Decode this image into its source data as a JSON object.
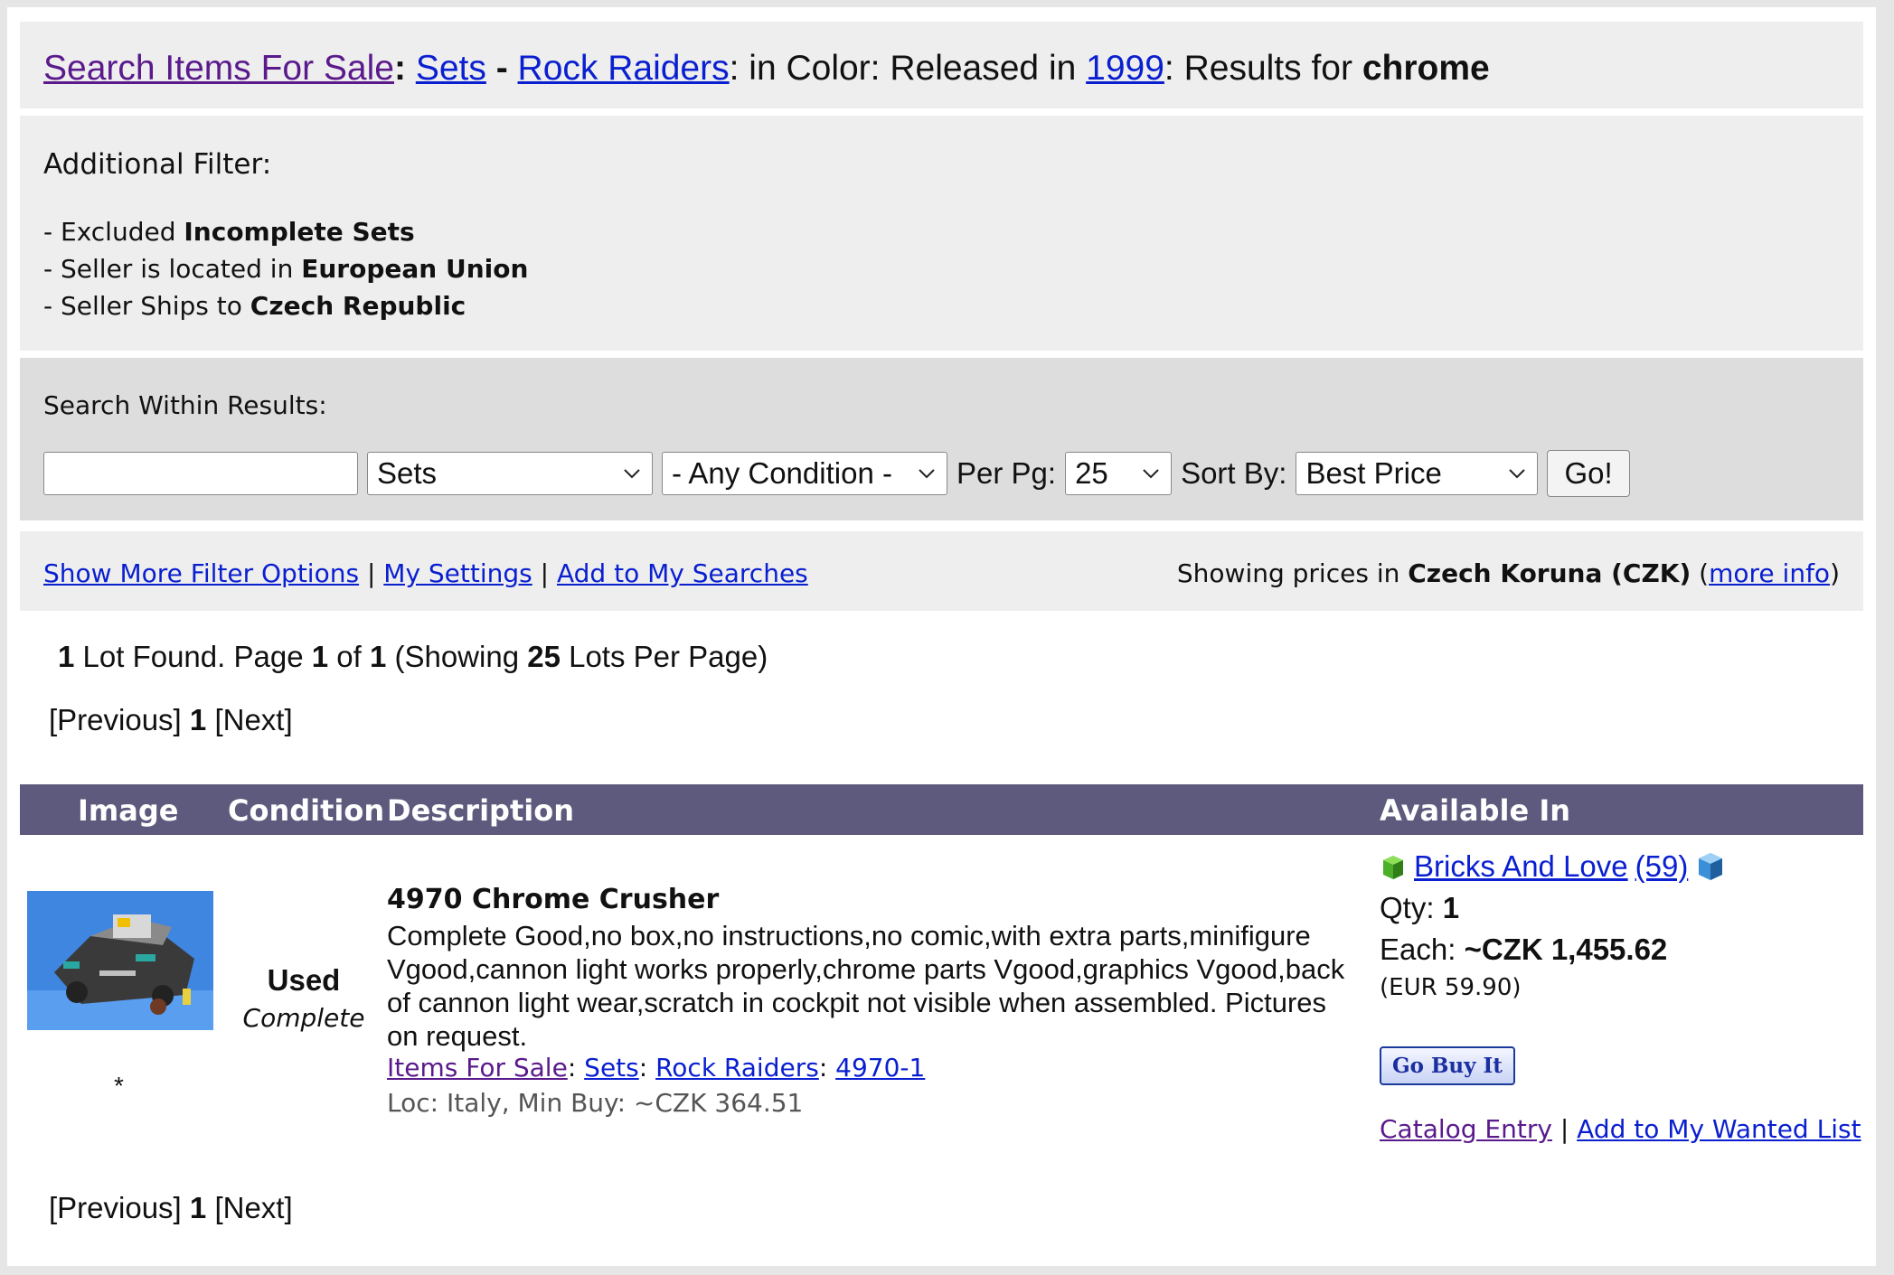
{
  "header": {
    "search_link": "Search Items For Sale",
    "sep1": ": ",
    "sets_link": "Sets",
    "sep2": " - ",
    "theme_link": "Rock Raiders",
    "sep3": ": in Color",
    "sep4": ": Released in ",
    "year_link": "1999",
    "sep5": ": Results for ",
    "query": "chrome"
  },
  "filter": {
    "heading": "Additional Filter:",
    "items": [
      {
        "prefix": "- Excluded ",
        "value": "Incomplete Sets"
      },
      {
        "prefix": "- Seller is located in ",
        "value": "European Union"
      },
      {
        "prefix": "- Seller Ships to ",
        "value": "Czech Republic"
      }
    ]
  },
  "search_within": {
    "heading": "Search Within Results:",
    "input_value": "",
    "type_select": "Sets",
    "condition_select": "- Any Condition -",
    "per_page_label": "Per Pg:",
    "per_page_select": "25",
    "sort_label": "Sort By:",
    "sort_select": "Best Price",
    "go_label": "Go!"
  },
  "links_bar": {
    "show_more": "Show More Filter Options",
    "my_settings": "My Settings",
    "add_searches": "Add to My Searches",
    "sep": " | ",
    "prices_prefix": "Showing prices in ",
    "currency": "Czech Koruna (CZK)",
    "more_info": "more info"
  },
  "results_summary": {
    "count": "1",
    "t1": " Lot Found. Page ",
    "page": "1",
    "t2": " of ",
    "pages": "1",
    "t3": " (Showing ",
    "per_page": "25",
    "t4": " Lots Per Page)"
  },
  "pager": {
    "prev": "[Previous]",
    "current": "1",
    "next": "[Next]"
  },
  "table": {
    "headers": [
      "Image",
      "Condition",
      "Description",
      "Available In"
    ]
  },
  "listing": {
    "star": "*",
    "condition": "Used",
    "completeness": "Complete",
    "name": "4970 Chrome Crusher",
    "description": "Complete Good,no box,no instructions,no comic,with extra parts,minifigure Vgood,cannon light works properly,chrome parts Vgood,graphics Vgood,back of cannon light wear,scratch in cockpit not visible when assembled. Pictures on request.",
    "crumb_items": "Items For Sale",
    "crumb_sets": "Sets",
    "crumb_theme": "Rock Raiders",
    "crumb_set": "4970-1",
    "location": "Loc: Italy, Min Buy: ~CZK 364.51",
    "store_name": "Bricks And Love",
    "store_feedback": "(59)",
    "qty_label": "Qty: ",
    "qty": "1",
    "each_label": "Each: ",
    "price": "~CZK 1,455.62",
    "eur": "(EUR 59.90)",
    "buy_button": "Go Buy It",
    "catalog_entry": "Catalog Entry",
    "add_wanted": "Add to My Wanted List"
  }
}
